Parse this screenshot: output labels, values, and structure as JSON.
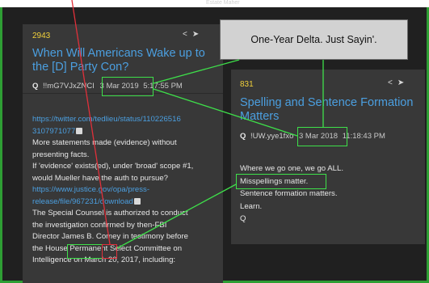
{
  "top_caption": "Estate Maher",
  "callout": {
    "text": "One-Year Delta. Just Sayin'."
  },
  "left_post": {
    "number": "2943",
    "title_line1": "When Will Americans Wake up to",
    "title_line2": "the [D] Party Con?",
    "author": "Q",
    "tripcode": "!!mG7VJxZNCI",
    "date": "3 Mar 2019",
    "time": "5:17:55 PM",
    "icons": [
      "share-icon",
      "arrow-right-circle-icon"
    ],
    "body": {
      "link1_line1": "https://twitter.com/tedlieu/status/110226516",
      "link1_line2": "3107971077",
      "line_a": "More statements made (evidence) without",
      "line_b": "presenting facts.",
      "line_c": "If 'evidence' exists(ed), under 'broad' scope #1,",
      "line_d": "would Mueller have the auth to pursue?",
      "link2_line1": "https://www.justice.gov/opa/press-",
      "link2_line2": "release/file/967231/download",
      "line_e": "The Special Counsel is authorized to conduct",
      "line_f": "the investigation confirmed by then-FBI",
      "line_g_pre": "Director ",
      "line_g_name": "James B. Comey",
      "line_g_post": " in testimony before",
      "line_h": "the House Permanent Select Committee on",
      "line_i": "Intelligence on March 20, 2017, including:"
    }
  },
  "right_post": {
    "number": "831",
    "title_line1": "Spelling and Sentence Formation",
    "title_line2": "Matters",
    "author": "Q",
    "tripcode": "!UW.yye1fxo",
    "date": "3 Mar 2018",
    "time": "11:18:43 PM",
    "icons": [
      "share-icon",
      "arrow-right-circle-icon"
    ],
    "body": {
      "line1": "Where we go one, we go ALL.",
      "line2": "Misspellings matter.",
      "line3": "Sentence formation matters.",
      "line4": "Learn.",
      "line5": "Q"
    }
  },
  "colors": {
    "accent_green": "#3ee04a",
    "accent_red": "#e0303a",
    "link_blue": "#4b9fe0",
    "post_number_yellow": "#f2d13b",
    "card_bg": "#383838",
    "page_bg": "#202020"
  }
}
